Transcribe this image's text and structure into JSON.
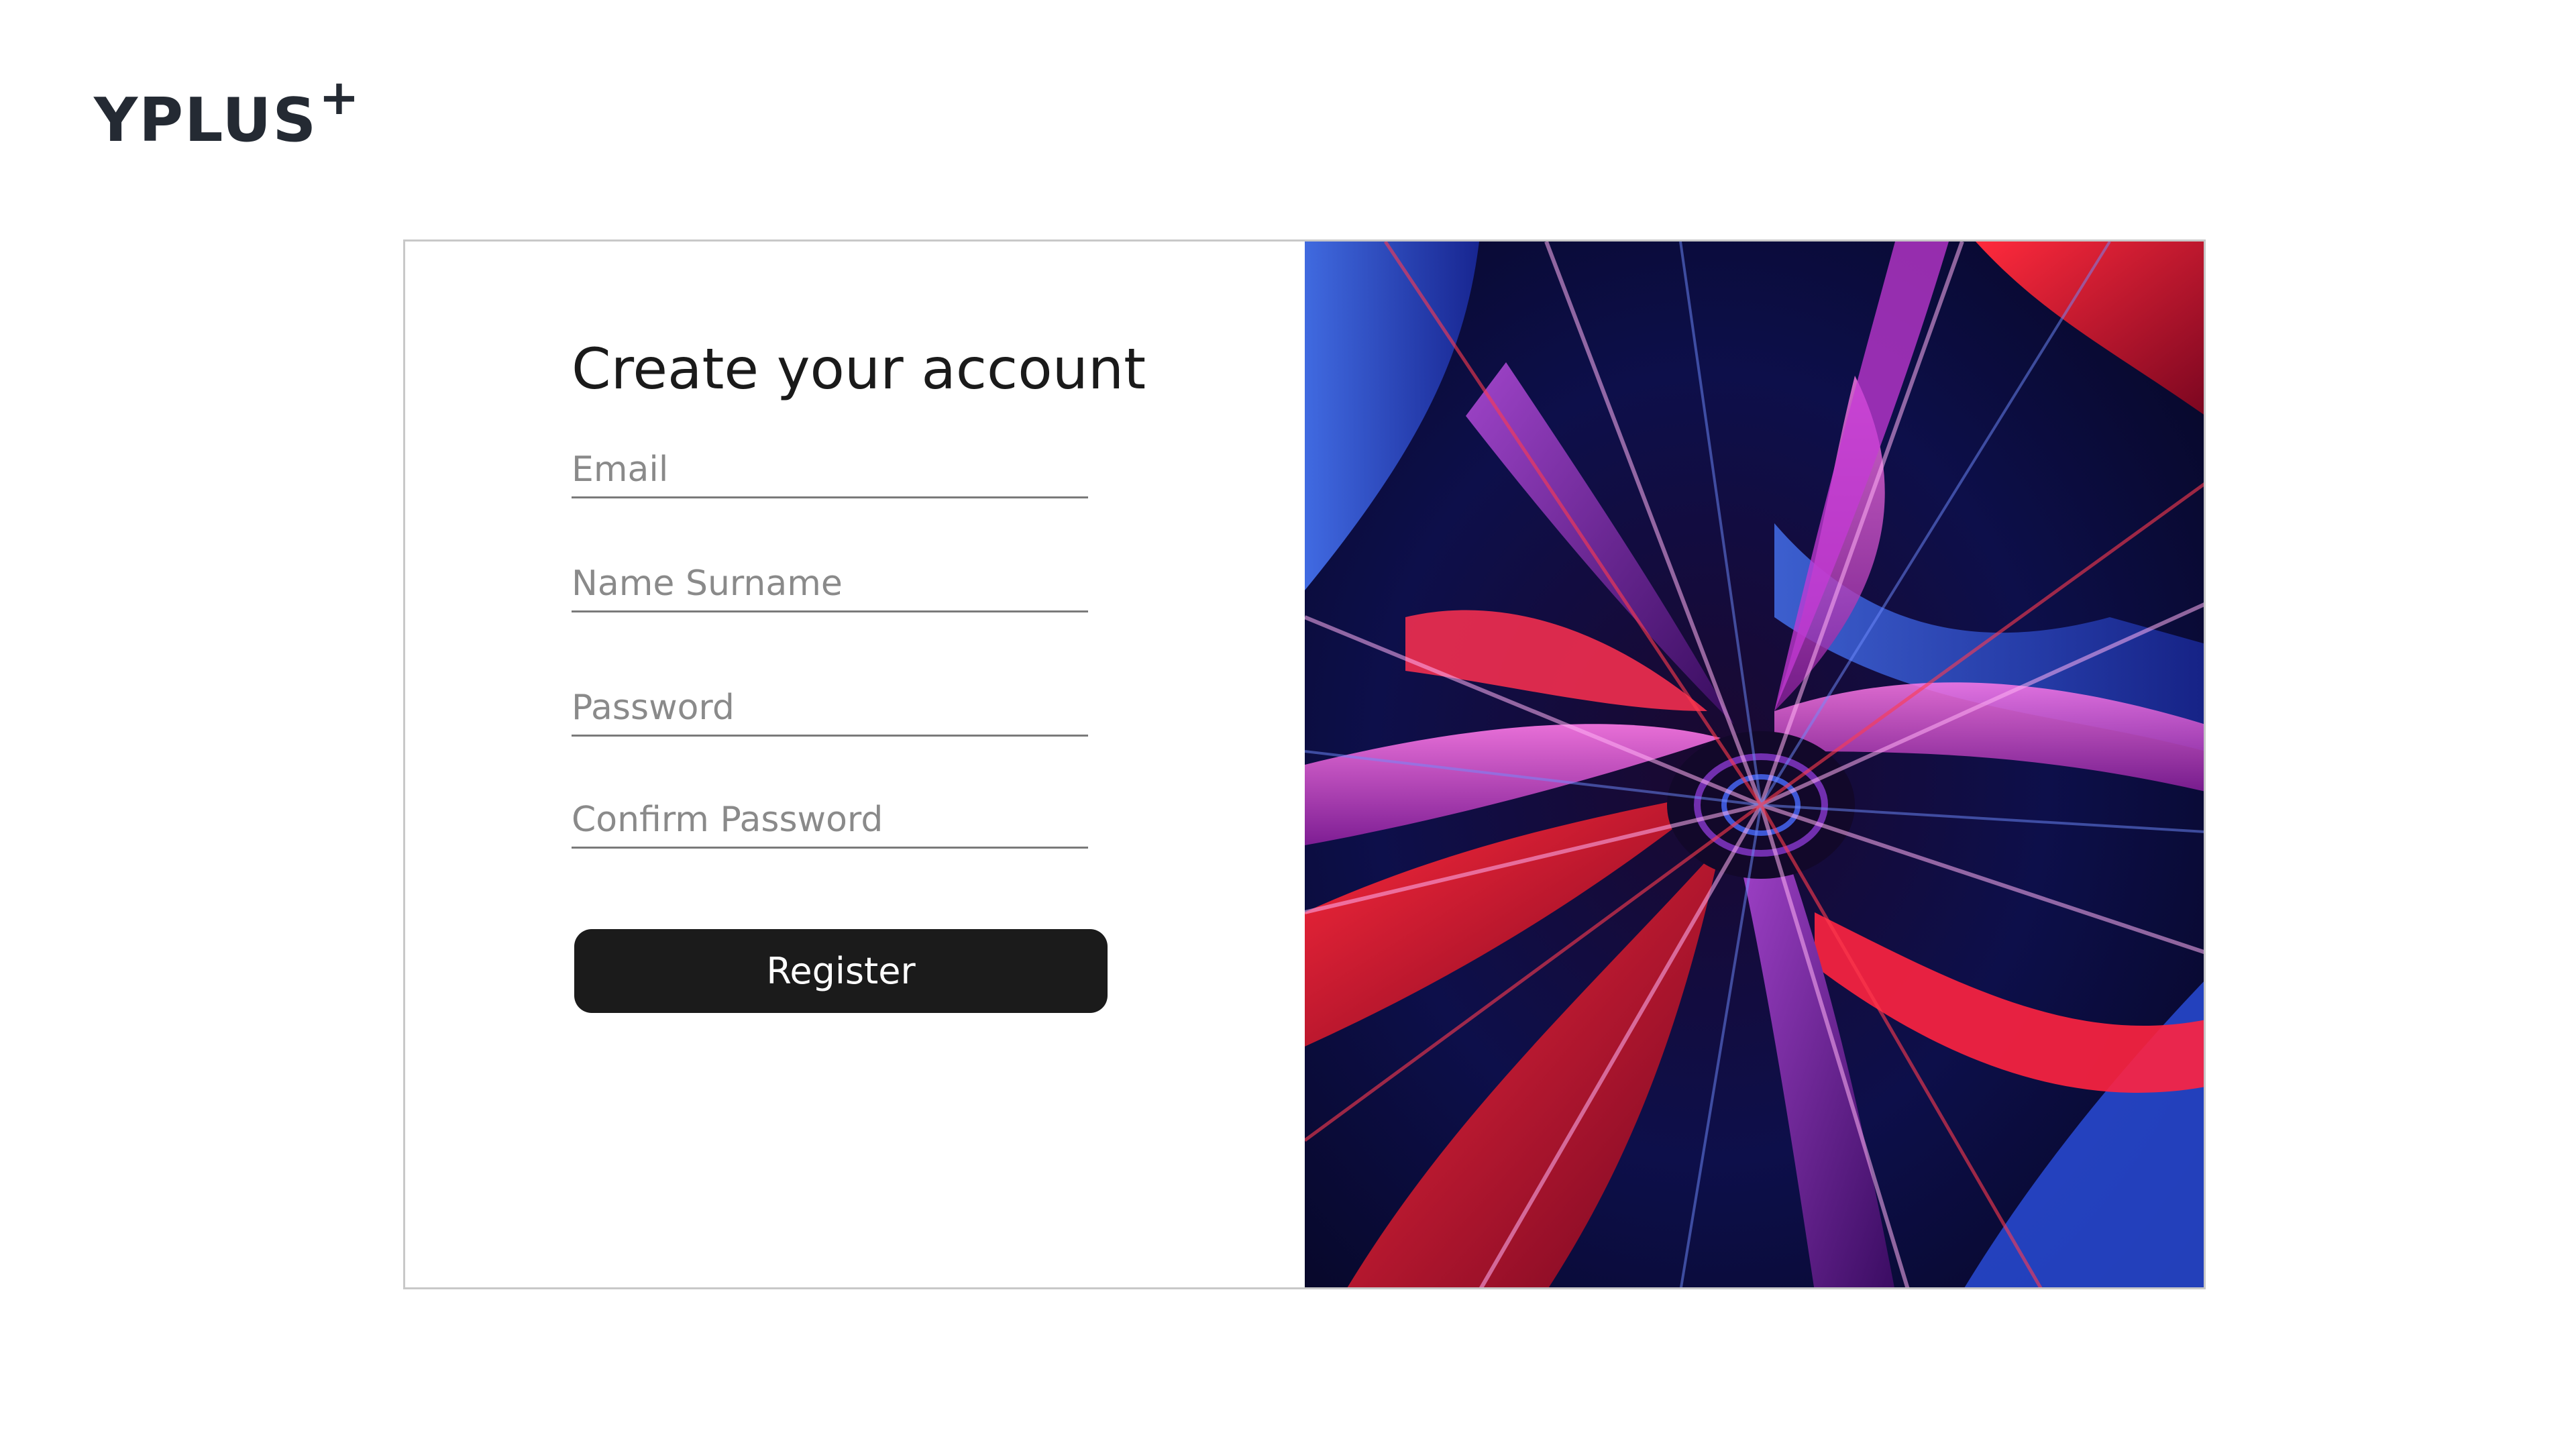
{
  "brand": {
    "name": "YPLUS",
    "mark": "+"
  },
  "form": {
    "title": "Create your account",
    "fields": {
      "email": {
        "placeholder": "Email"
      },
      "name": {
        "placeholder": "Name Surname"
      },
      "password": {
        "placeholder": "Password"
      },
      "confirm_password": {
        "placeholder": "Confirm Password"
      }
    },
    "submit_label": "Register"
  },
  "theme": {
    "button_color": "#1b1b1b",
    "logo_color": "#242a33",
    "art_colors": [
      "#0a0b3a",
      "#e0102a",
      "#3a5ef0",
      "#c53ad6",
      "#5a1070"
    ]
  }
}
